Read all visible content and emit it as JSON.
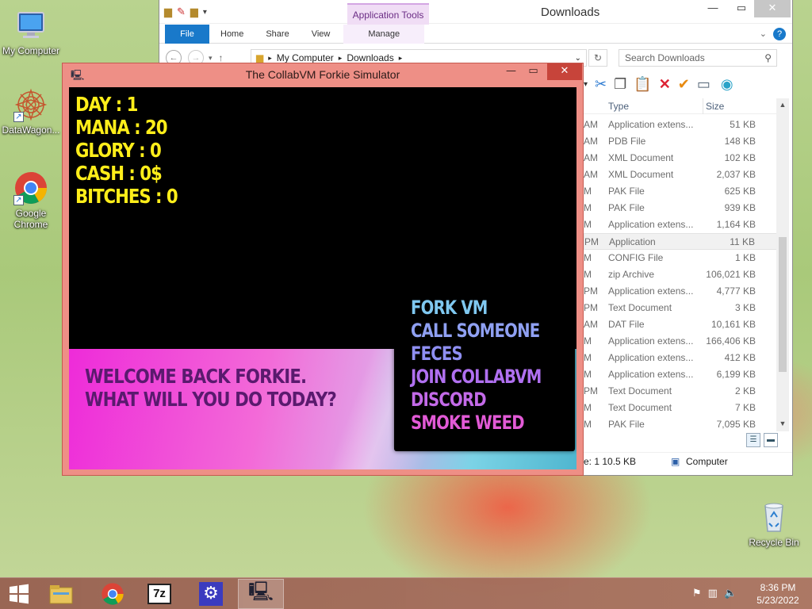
{
  "desktop": {
    "icons": [
      {
        "label": "My Computer",
        "icon": "monitor-icon"
      },
      {
        "label": "DataWagon...",
        "icon": "mandala-icon"
      },
      {
        "label": "Google Chrome",
        "icon": "chrome-icon"
      },
      {
        "label": "Recycle Bin",
        "icon": "recycle-bin-icon"
      }
    ]
  },
  "explorer": {
    "title": "Downloads",
    "context_tab": "Application Tools",
    "tabs": [
      "File",
      "Home",
      "Share",
      "View",
      "Manage"
    ],
    "address": [
      "My Computer",
      "Downloads"
    ],
    "search_placeholder": "Search Downloads",
    "columns": {
      "type": "Type",
      "size": "Size"
    },
    "files": [
      {
        "prefix": "AM",
        "type": "Application extens...",
        "size": "51 KB"
      },
      {
        "prefix": "AM",
        "type": "PDB File",
        "size": "148 KB"
      },
      {
        "prefix": "AM",
        "type": "XML Document",
        "size": "102 KB"
      },
      {
        "prefix": "AM",
        "type": "XML Document",
        "size": "2,037 KB"
      },
      {
        "prefix": "M",
        "type": "PAK File",
        "size": "625 KB"
      },
      {
        "prefix": "M",
        "type": "PAK File",
        "size": "939 KB"
      },
      {
        "prefix": "M",
        "type": "Application extens...",
        "size": "1,164 KB"
      },
      {
        "prefix": "PM",
        "type": "Application",
        "size": "11 KB",
        "selected": true
      },
      {
        "prefix": "M",
        "type": "CONFIG File",
        "size": "1 KB"
      },
      {
        "prefix": "M",
        "type": "zip Archive",
        "size": "106,021 KB"
      },
      {
        "prefix": "PM",
        "type": "Application extens...",
        "size": "4,777 KB"
      },
      {
        "prefix": "PM",
        "type": "Text Document",
        "size": "3 KB"
      },
      {
        "prefix": "AM",
        "type": "DAT File",
        "size": "10,161 KB"
      },
      {
        "prefix": "M",
        "type": "Application extens...",
        "size": "166,406 KB"
      },
      {
        "prefix": "M",
        "type": "Application extens...",
        "size": "412 KB"
      },
      {
        "prefix": "M",
        "type": "Application extens...",
        "size": "6,199 KB"
      },
      {
        "prefix": "PM",
        "type": "Text Document",
        "size": "2 KB"
      },
      {
        "prefix": "M",
        "type": "Text Document",
        "size": "7 KB"
      },
      {
        "prefix": "M",
        "type": "PAK File",
        "size": "7,095 KB"
      }
    ],
    "status_left": "e: 1 10.5 KB",
    "status_right": "Computer"
  },
  "forkie": {
    "title": "The CollabVM Forkie Simulator",
    "stats": [
      "DAY : 1",
      "MANA : 20",
      "GLORY : 0",
      "CASH : 0$",
      "BITCHES : 0"
    ],
    "welcome": [
      "WELCOME BACK FORKIE.",
      "WHAT WILL YOU DO TODAY?"
    ],
    "menu": [
      {
        "label": "FORK VM",
        "color": "#7fc8f0"
      },
      {
        "label": "CALL SOMEONE",
        "color": "#8fa0f2"
      },
      {
        "label": "FECES",
        "color": "#8f8ff2"
      },
      {
        "label": "JOIN COLLABVM",
        "color": "#b070f0"
      },
      {
        "label": "DISCORD",
        "color": "#c36ae8"
      },
      {
        "label": "SMOKE WEED",
        "color": "#e25ad6"
      }
    ]
  },
  "taskbar": {
    "apps": [
      "start-icon",
      "file-explorer-icon",
      "chrome-icon",
      "7zip-icon",
      "settings-gear-icon",
      "collabvm-app-icon"
    ],
    "sevenzip_label": "7z",
    "time": "8:36 PM",
    "date": "5/23/2022"
  },
  "colors": {
    "stats_yellow": "#ffee1a",
    "welcome_purple": "#5a1a6e",
    "title_red": "#ee8f86"
  }
}
